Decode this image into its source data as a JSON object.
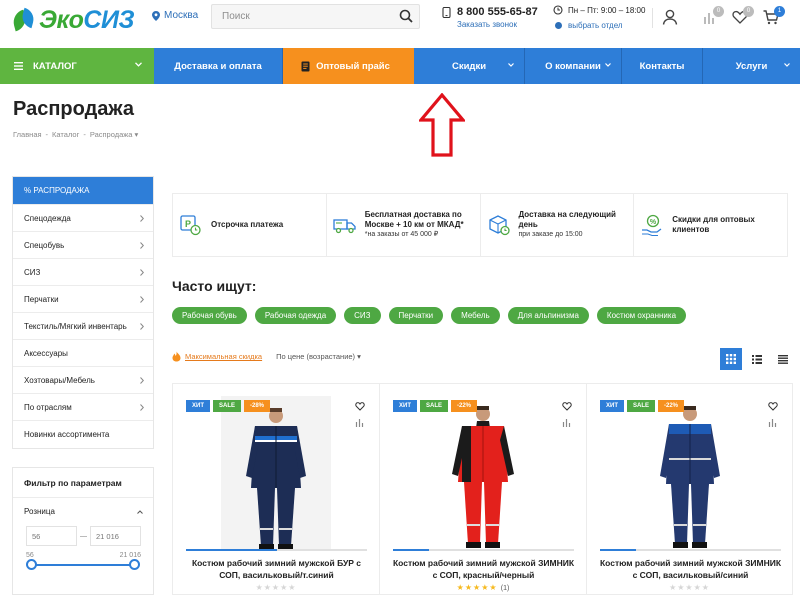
{
  "brand": {
    "part1": "Эко",
    "part2": "СИЗ"
  },
  "header": {
    "city": "Москва",
    "search_placeholder": "Поиск",
    "phone": "8 800 555-65-87",
    "callback": "Заказать звонок",
    "hours": "Пн – Пт: 9:00 – 18:00",
    "choose_dept": "выбрать отдел",
    "compare_count": "0",
    "favorites_count": "0",
    "cart_count": "1"
  },
  "colors": {
    "accent_blue": "#2e7ed8",
    "accent_green": "#5fb540",
    "accent_orange": "#f6901e"
  },
  "nav": {
    "catalog": "КАТАЛОГ",
    "items": [
      "Доставка и оплата",
      "Оптовый прайс",
      "Скидки",
      "О компании",
      "Контакты",
      "Услуги"
    ]
  },
  "page": {
    "title": "Распродажа",
    "breadcrumb": [
      "Главная",
      "Каталог",
      "Распродажа"
    ]
  },
  "sidebar": {
    "items": [
      "% РАСПРОДАЖА",
      "Спецодежда",
      "Спецобувь",
      "СИЗ",
      "Перчатки",
      "Текстиль/Мягкий инвентарь",
      "Аксессуары",
      "Хозтовары/Мебель",
      "По отраслям",
      "Новинки ассортимента"
    ],
    "filter_title": "Фильтр по параметрам",
    "filter_group": "Розница",
    "range_min_placeholder": "56",
    "range_max_placeholder": "21 016",
    "range_min_label": "56",
    "range_max_label": "21 016"
  },
  "features": [
    {
      "title": "Отсрочка платежа",
      "sub": ""
    },
    {
      "title": "Бесплатная доставка по Москве + 10 км от МКАД*",
      "sub": "*на заказы от 45 000 ₽"
    },
    {
      "title": "Доставка на следующий день",
      "sub": "при заказе до 15:00"
    },
    {
      "title": "Скидки для оптовых клиентов",
      "sub": ""
    }
  ],
  "popular": {
    "title": "Часто ищут:",
    "tags": [
      "Рабочая обувь",
      "Рабочая одежда",
      "СИЗ",
      "Перчатки",
      "Мебель",
      "Для альпинизма",
      "Костюм охранника"
    ]
  },
  "sort": {
    "max_discount": "Максимальная скидка",
    "by_price": "По цене (возрастание)"
  },
  "products": [
    {
      "hit": "ХИТ",
      "sale": "SALE",
      "discount": "-28%",
      "name": "Костюм рабочий зимний мужской БУР с СОП, васильковый/т.синий",
      "rating": 0,
      "reviews": "",
      "slide_fraction": 0.5
    },
    {
      "hit": "ХИТ",
      "sale": "SALE",
      "discount": "-22%",
      "name": "Костюм рабочий зимний мужской ЗИМНИК с СОП, красный/черный",
      "rating": 5,
      "reviews": "(1)",
      "slide_fraction": 0.2
    },
    {
      "hit": "ХИТ",
      "sale": "SALE",
      "discount": "-22%",
      "name": "Костюм рабочий зимний мужской ЗИМНИК с СОП, васильковый/синий",
      "rating": 0,
      "reviews": "",
      "slide_fraction": 0.2
    }
  ]
}
